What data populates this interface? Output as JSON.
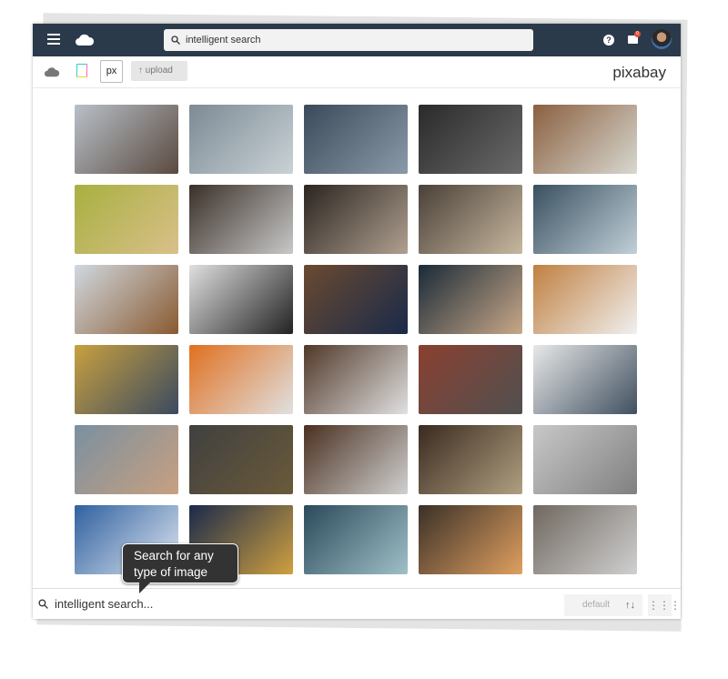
{
  "header": {
    "search_value": "intelligent search",
    "help": "?",
    "notification_count": "0"
  },
  "toolbar": {
    "px_label": "px",
    "upload_label": "upload",
    "brand": "pixabay"
  },
  "tiles": [
    [
      "#b8c0c8",
      "#5a4a40"
    ],
    [
      "#7c8a94",
      "#c9d2d6"
    ],
    [
      "#3a4a5a",
      "#8a9aa8"
    ],
    [
      "#2a2a2a",
      "#6a6a6a"
    ],
    [
      "#8a6040",
      "#d8d8d0"
    ],
    [
      "#a8b040",
      "#d9c08a"
    ],
    [
      "#3a3028",
      "#c8c8c8"
    ],
    [
      "#2a2420",
      "#b0a090"
    ],
    [
      "#4a4038",
      "#c8b8a0"
    ],
    [
      "#3a5060",
      "#c0d0d8"
    ],
    [
      "#d0d8e0",
      "#8a5a30"
    ],
    [
      "#e0e0e0",
      "#222222"
    ],
    [
      "#6a4a30",
      "#1a2a4a"
    ],
    [
      "#1a2a38",
      "#c8a888"
    ],
    [
      "#c08040",
      "#f0f0f0"
    ],
    [
      "#c8a040",
      "#3a4a60"
    ],
    [
      "#e07020",
      "#e0e0e0"
    ],
    [
      "#503828",
      "#e0e0e0"
    ],
    [
      "#8a4030",
      "#505050"
    ],
    [
      "#e8e8e8",
      "#405060"
    ],
    [
      "#7a90a0",
      "#c8a080"
    ],
    [
      "#404040",
      "#6a5a3a"
    ],
    [
      "#4a3020",
      "#d0d0d0"
    ],
    [
      "#3a2a20",
      "#b0a080"
    ],
    [
      "#c8c8c8",
      "#808080"
    ],
    [
      "#3060a0",
      "#e0e8f0"
    ],
    [
      "#1a2a4a",
      "#d0a040"
    ],
    [
      "#2a4a5a",
      "#a0c0c8"
    ],
    [
      "#3a3028",
      "#e0a060"
    ],
    [
      "#706860",
      "#d0d0d0"
    ]
  ],
  "bottom": {
    "search_value": "intelligent search...",
    "sort_label": "default",
    "sort_icon": "↑↓",
    "grid_icon": "⋮⋮⋮"
  },
  "tooltip": {
    "text": "Search for any type of image"
  }
}
